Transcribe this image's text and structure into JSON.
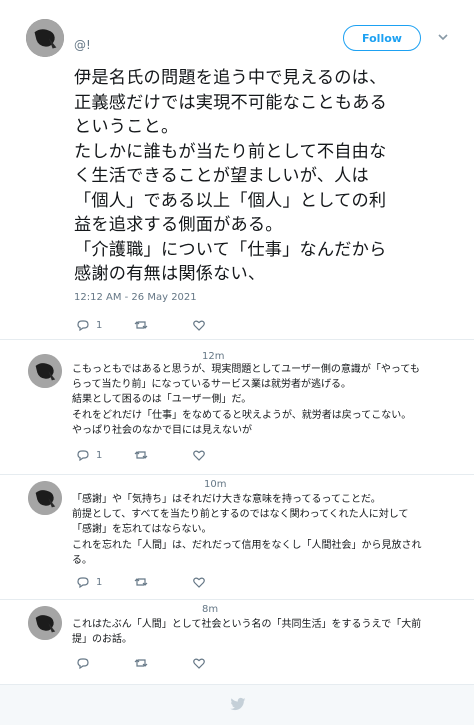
{
  "main_tweet": {
    "handle": "@!",
    "follow_label": "Follow",
    "text": "伊是名氏の問題を追う中で見えるのは、\n正義感だけでは実現不可能なこともある\nということ。\nたしかに誰もが当たり前として不自由な\nく生活できることが望ましいが、人は\n「個人」である以上「個人」としての利\n益を追求する側面がある。\n「介護職」について「仕事」なんだから\n感謝の有無は関係ない、",
    "timestamp": "12:12 AM - 26 May 2021",
    "reply_count": "1"
  },
  "replies": [
    {
      "time": "12m",
      "text": "こもっともではあると思うが、現実問題としてユーザー側の意識が「やっても\nらって当たり前」になっているサービス業は就労者が逃げる。\n結果として困るのは「ユーザー側」だ。\nそれをどれだけ「仕事」をなめてると吠えようが、就労者は戻ってこない。\nやっぱり社会のなかで目には見えないが",
      "reply_count": "1"
    },
    {
      "time": "10m",
      "text": "「感謝」や「気持ち」はそれだけ大きな意味を持ってるってことだ。\n前提として、すべてを当たり前とするのではなく関わってくれた人に対して\n「感謝」を忘れてはならない。\nこれを忘れた「人間」は、だれだって信用をなくし「人間社会」から見放され\nる。",
      "reply_count": "1"
    },
    {
      "time": "8m",
      "text": "これはたぶん「人間」として社会という名の「共同生活」をするうえで「大前\n提」のお話。",
      "reply_count": ""
    }
  ],
  "icons": {
    "reply": "reply-icon",
    "retweet": "retweet-icon",
    "like": "heart-icon",
    "more": "chevron-down-icon",
    "footer": "twitter-bird-icon"
  },
  "colors": {
    "accent": "#1da1f2",
    "muted": "#657786",
    "border": "#e6ecf0"
  }
}
